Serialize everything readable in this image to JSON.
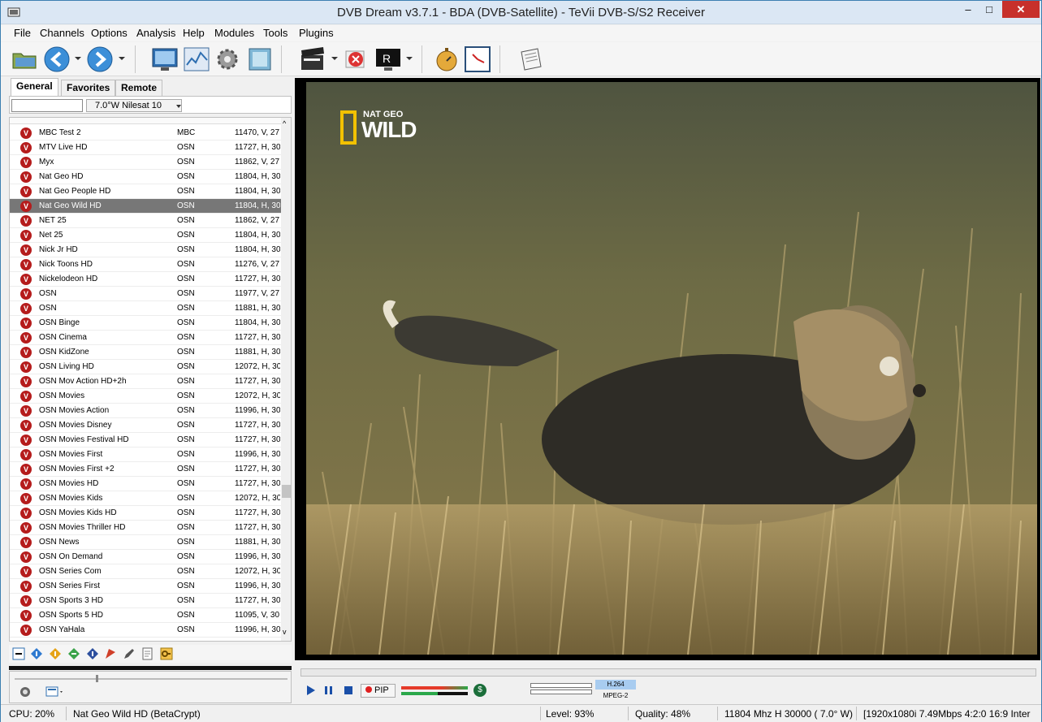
{
  "window": {
    "title": "DVB Dream v3.7.1 - BDA (DVB-Satellite)  -  TeVii DVB-S/S2 Receiver",
    "min": "–",
    "max": "□",
    "close": "✕"
  },
  "menu": [
    "File",
    "Channels",
    "Options",
    "Analysis",
    "Help",
    "Modules",
    "Tools",
    "Plugins"
  ],
  "tabs": [
    "General",
    "Favorites",
    "Remote"
  ],
  "satellite_select": "7.0°W Nilesat 10",
  "channels": [
    {
      "name": "MBC Test 2",
      "provider": "MBC",
      "freq": "11470, V, 27"
    },
    {
      "name": "MTV Live HD",
      "provider": "OSN",
      "freq": "11727, H, 30"
    },
    {
      "name": "Myx",
      "provider": "OSN",
      "freq": "11862, V, 27"
    },
    {
      "name": "Nat Geo HD",
      "provider": "OSN",
      "freq": "11804, H, 30"
    },
    {
      "name": "Nat Geo People HD",
      "provider": "OSN",
      "freq": "11804, H, 30"
    },
    {
      "name": "Nat Geo Wild HD",
      "provider": "OSN",
      "freq": "11804, H, 30"
    },
    {
      "name": "NET 25",
      "provider": "OSN",
      "freq": "11862, V, 27"
    },
    {
      "name": "Net 25",
      "provider": "OSN",
      "freq": "11804, H, 30"
    },
    {
      "name": "Nick Jr HD",
      "provider": "OSN",
      "freq": "11804, H, 30"
    },
    {
      "name": "Nick Toons HD",
      "provider": "OSN",
      "freq": "11276, V, 27"
    },
    {
      "name": "Nickelodeon HD",
      "provider": "OSN",
      "freq": "11727, H, 30"
    },
    {
      "name": "OSN",
      "provider": "OSN",
      "freq": "11977, V, 27"
    },
    {
      "name": "OSN",
      "provider": "OSN",
      "freq": "11881, H, 30"
    },
    {
      "name": "OSN Binge",
      "provider": "OSN",
      "freq": "11804, H, 30"
    },
    {
      "name": "OSN Cinema",
      "provider": "OSN",
      "freq": "11727, H, 30"
    },
    {
      "name": "OSN KidZone",
      "provider": "OSN",
      "freq": "11881, H, 30"
    },
    {
      "name": "OSN Living HD",
      "provider": "OSN",
      "freq": "12072, H, 30"
    },
    {
      "name": "OSN Mov Action HD+2h",
      "provider": "OSN",
      "freq": "11727, H, 30"
    },
    {
      "name": "OSN Movies",
      "provider": "OSN",
      "freq": "12072, H, 30"
    },
    {
      "name": "OSN Movies Action",
      "provider": "OSN",
      "freq": "11996, H, 30"
    },
    {
      "name": "OSN Movies Disney",
      "provider": "OSN",
      "freq": "11727, H, 30"
    },
    {
      "name": "OSN Movies Festival HD",
      "provider": "OSN",
      "freq": "11727, H, 30"
    },
    {
      "name": "OSN Movies First",
      "provider": "OSN",
      "freq": "11996, H, 30"
    },
    {
      "name": "OSN Movies First +2",
      "provider": "OSN",
      "freq": "11727, H, 30"
    },
    {
      "name": "OSN Movies HD",
      "provider": "OSN",
      "freq": "11727, H, 30"
    },
    {
      "name": "OSN Movies Kids",
      "provider": "OSN",
      "freq": "12072, H, 30"
    },
    {
      "name": "OSN Movies Kids HD",
      "provider": "OSN",
      "freq": "11727, H, 30"
    },
    {
      "name": "OSN Movies Thriller HD",
      "provider": "OSN",
      "freq": "11727, H, 30"
    },
    {
      "name": "OSN News",
      "provider": "OSN",
      "freq": "11881, H, 30"
    },
    {
      "name": "OSN On Demand",
      "provider": "OSN",
      "freq": "11996, H, 30"
    },
    {
      "name": "OSN Series Com",
      "provider": "OSN",
      "freq": "12072, H, 30"
    },
    {
      "name": "OSN Series First",
      "provider": "OSN",
      "freq": "11996, H, 30"
    },
    {
      "name": "OSN Sports 3 HD",
      "provider": "OSN",
      "freq": "11727, H, 30"
    },
    {
      "name": "OSN Sports 5 HD",
      "provider": "OSN",
      "freq": "11095, V, 30"
    },
    {
      "name": "OSN YaHala",
      "provider": "OSN",
      "freq": "11996, H, 30"
    }
  ],
  "selected_channel": "Nat Geo Wild HD",
  "video_logo": {
    "line1": "NAT GEO",
    "line2": "WILD"
  },
  "controls": {
    "pip": "PIP",
    "codec_video": "H.264",
    "codec_audio": "MPEG-2"
  },
  "status": {
    "cpu": "CPU: 20%",
    "channel": "Nat Geo Wild HD (BetaCrypt)",
    "level": "Level: 93%",
    "quality": "Quality: 48%",
    "tuning": "11804 Mhz  H  30000  ( 7.0° W)",
    "stream": "[1920x1080i  7.49Mbps 4:2:0  16:9 Inter"
  },
  "colors": {
    "accent": "#3c7fb1",
    "close": "#c7302b",
    "channel_icon": "#b51c1c",
    "selection": "#777777"
  }
}
